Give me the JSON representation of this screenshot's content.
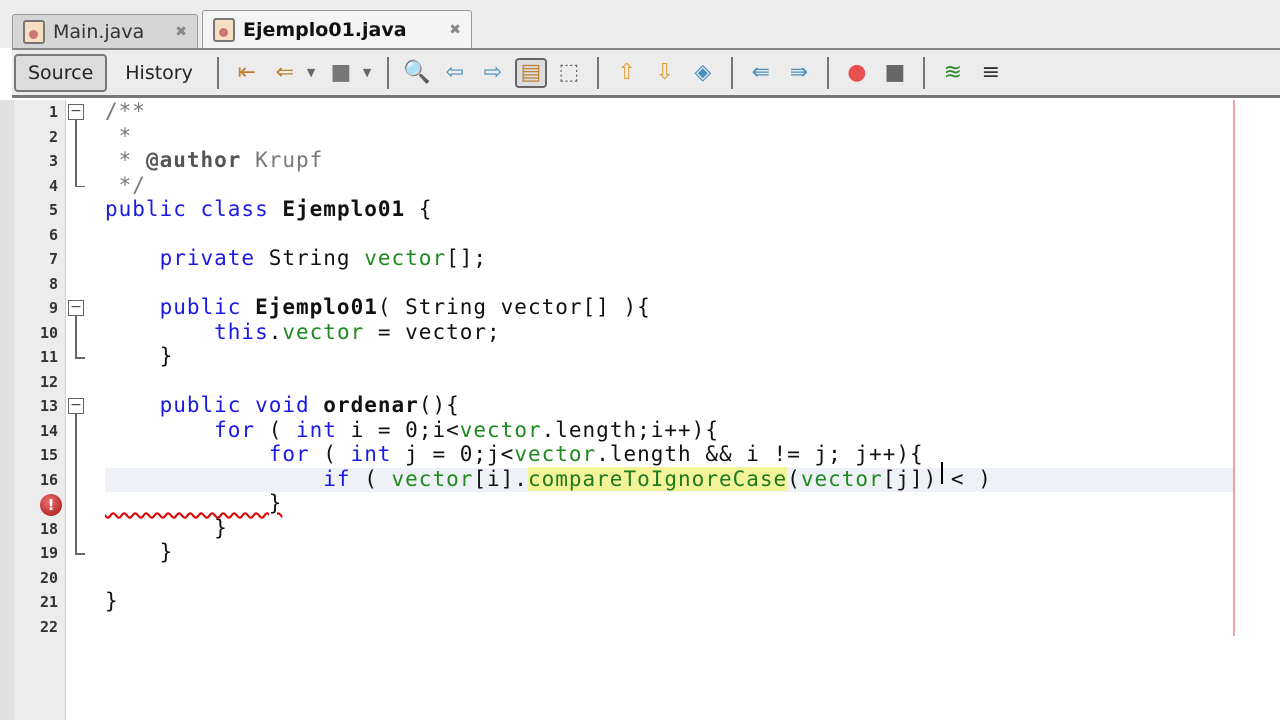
{
  "tabs": [
    {
      "label": "Main.java",
      "active": false
    },
    {
      "label": "Ejemplo01.java",
      "active": true
    }
  ],
  "toolbar": {
    "source": "Source",
    "history": "History",
    "icons": [
      "last-edit-icon",
      "prev-bookmark-icon",
      "toggle-icon",
      "find-selection-icon",
      "find-previous-icon",
      "find-next-icon",
      "toggle-highlight-icon",
      "rect-selection-icon",
      "previous-bookmark-icon",
      "next-bookmark-icon",
      "toggle-bookmark-icon",
      "shift-left-icon",
      "shift-right-icon",
      "record-macro-icon",
      "stop-macro-icon",
      "comment-icon",
      "uncomment-icon"
    ]
  },
  "editor": {
    "error_line": 17,
    "lines": [
      {
        "n": "1",
        "tokens": [
          {
            "t": "/**",
            "c": "cm"
          }
        ]
      },
      {
        "n": "2",
        "tokens": [
          {
            "t": " *",
            "c": "cm"
          }
        ]
      },
      {
        "n": "3",
        "tokens": [
          {
            "t": " * ",
            "c": "cm"
          },
          {
            "t": "@author",
            "c": "cmb"
          },
          {
            "t": " Krupf",
            "c": "cm"
          }
        ]
      },
      {
        "n": "4",
        "tokens": [
          {
            "t": " */",
            "c": "cm"
          }
        ]
      },
      {
        "n": "5",
        "tokens": [
          {
            "t": "public class ",
            "c": "kw"
          },
          {
            "t": "Ejemplo01",
            "c": "b"
          },
          {
            "t": " {",
            "c": "pl"
          }
        ]
      },
      {
        "n": "6",
        "tokens": []
      },
      {
        "n": "7",
        "tokens": [
          {
            "t": "    private ",
            "c": "kw"
          },
          {
            "t": "String ",
            "c": "pl"
          },
          {
            "t": "vector",
            "c": "fd"
          },
          {
            "t": "[];",
            "c": "pl"
          }
        ]
      },
      {
        "n": "8",
        "tokens": []
      },
      {
        "n": "9",
        "tokens": [
          {
            "t": "    public ",
            "c": "kw"
          },
          {
            "t": "Ejemplo01",
            "c": "b"
          },
          {
            "t": "( String vector[] ){",
            "c": "pl"
          }
        ]
      },
      {
        "n": "10",
        "tokens": [
          {
            "t": "        this",
            "c": "kw"
          },
          {
            "t": ".",
            "c": "pl"
          },
          {
            "t": "vector",
            "c": "fd"
          },
          {
            "t": " = vector;",
            "c": "pl"
          }
        ]
      },
      {
        "n": "11",
        "tokens": [
          {
            "t": "    }",
            "c": "pl"
          }
        ]
      },
      {
        "n": "12",
        "tokens": []
      },
      {
        "n": "13",
        "tokens": [
          {
            "t": "    public void ",
            "c": "kw"
          },
          {
            "t": "ordenar",
            "c": "b"
          },
          {
            "t": "(){",
            "c": "pl"
          }
        ]
      },
      {
        "n": "14",
        "tokens": [
          {
            "t": "        for",
            "c": "kw"
          },
          {
            "t": " ( ",
            "c": "pl"
          },
          {
            "t": "int",
            "c": "kw"
          },
          {
            "t": " i = 0;i<",
            "c": "pl"
          },
          {
            "t": "vector",
            "c": "fd"
          },
          {
            "t": ".length;i++){",
            "c": "pl"
          }
        ]
      },
      {
        "n": "15",
        "tokens": [
          {
            "t": "            for",
            "c": "kw"
          },
          {
            "t": " ( ",
            "c": "pl"
          },
          {
            "t": "int",
            "c": "kw"
          },
          {
            "t": " j = 0;j<",
            "c": "pl"
          },
          {
            "t": "vector",
            "c": "fd"
          },
          {
            "t": ".length && i != j; j++){",
            "c": "pl"
          }
        ]
      },
      {
        "n": "16",
        "tokens": [
          {
            "t": "                if",
            "c": "kw"
          },
          {
            "t": " ( ",
            "c": "pl"
          },
          {
            "t": "vector",
            "c": "fd"
          },
          {
            "t": "[i].",
            "c": "pl"
          },
          {
            "t": "compareToIgnoreCase",
            "c": "mth"
          },
          {
            "t": "(",
            "c": "pl"
          },
          {
            "t": "vector",
            "c": "fd"
          },
          {
            "t": "[j]) < )",
            "c": "pl"
          }
        ]
      },
      {
        "n": "17",
        "tokens": [
          {
            "t": "            }",
            "c": "pl"
          }
        ]
      },
      {
        "n": "18",
        "tokens": [
          {
            "t": "        }",
            "c": "pl"
          }
        ]
      },
      {
        "n": "19",
        "tokens": [
          {
            "t": "    }",
            "c": "pl"
          }
        ]
      },
      {
        "n": "20",
        "tokens": []
      },
      {
        "n": "21",
        "tokens": [
          {
            "t": "}",
            "c": "pl"
          }
        ]
      },
      {
        "n": "22",
        "tokens": []
      }
    ]
  },
  "colors": {
    "keyword": "#1a1ae6",
    "field": "#1f8a1f",
    "comment": "#777777",
    "error": "#c01010"
  }
}
